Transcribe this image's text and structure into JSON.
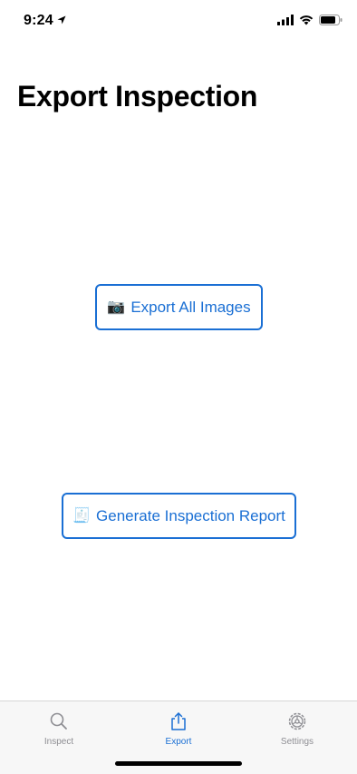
{
  "status": {
    "time": "9:24"
  },
  "page": {
    "title": "Export Inspection"
  },
  "actions": {
    "export_images": {
      "icon": "camera-icon",
      "glyph": "📷",
      "label": "Export All Images"
    },
    "generate_report": {
      "icon": "receipt-icon",
      "glyph": "🧾",
      "label": "Generate Inspection Report"
    }
  },
  "tabs": [
    {
      "label": "Inspect",
      "icon": "search-icon",
      "selected": false
    },
    {
      "label": "Export",
      "icon": "share-icon",
      "selected": true
    },
    {
      "label": "Settings",
      "icon": "gear-icon",
      "selected": false
    }
  ],
  "colors": {
    "accent": "#1a6fd4",
    "inactive": "#8e8e93",
    "tab_bar_bg": "#f7f7f7"
  }
}
